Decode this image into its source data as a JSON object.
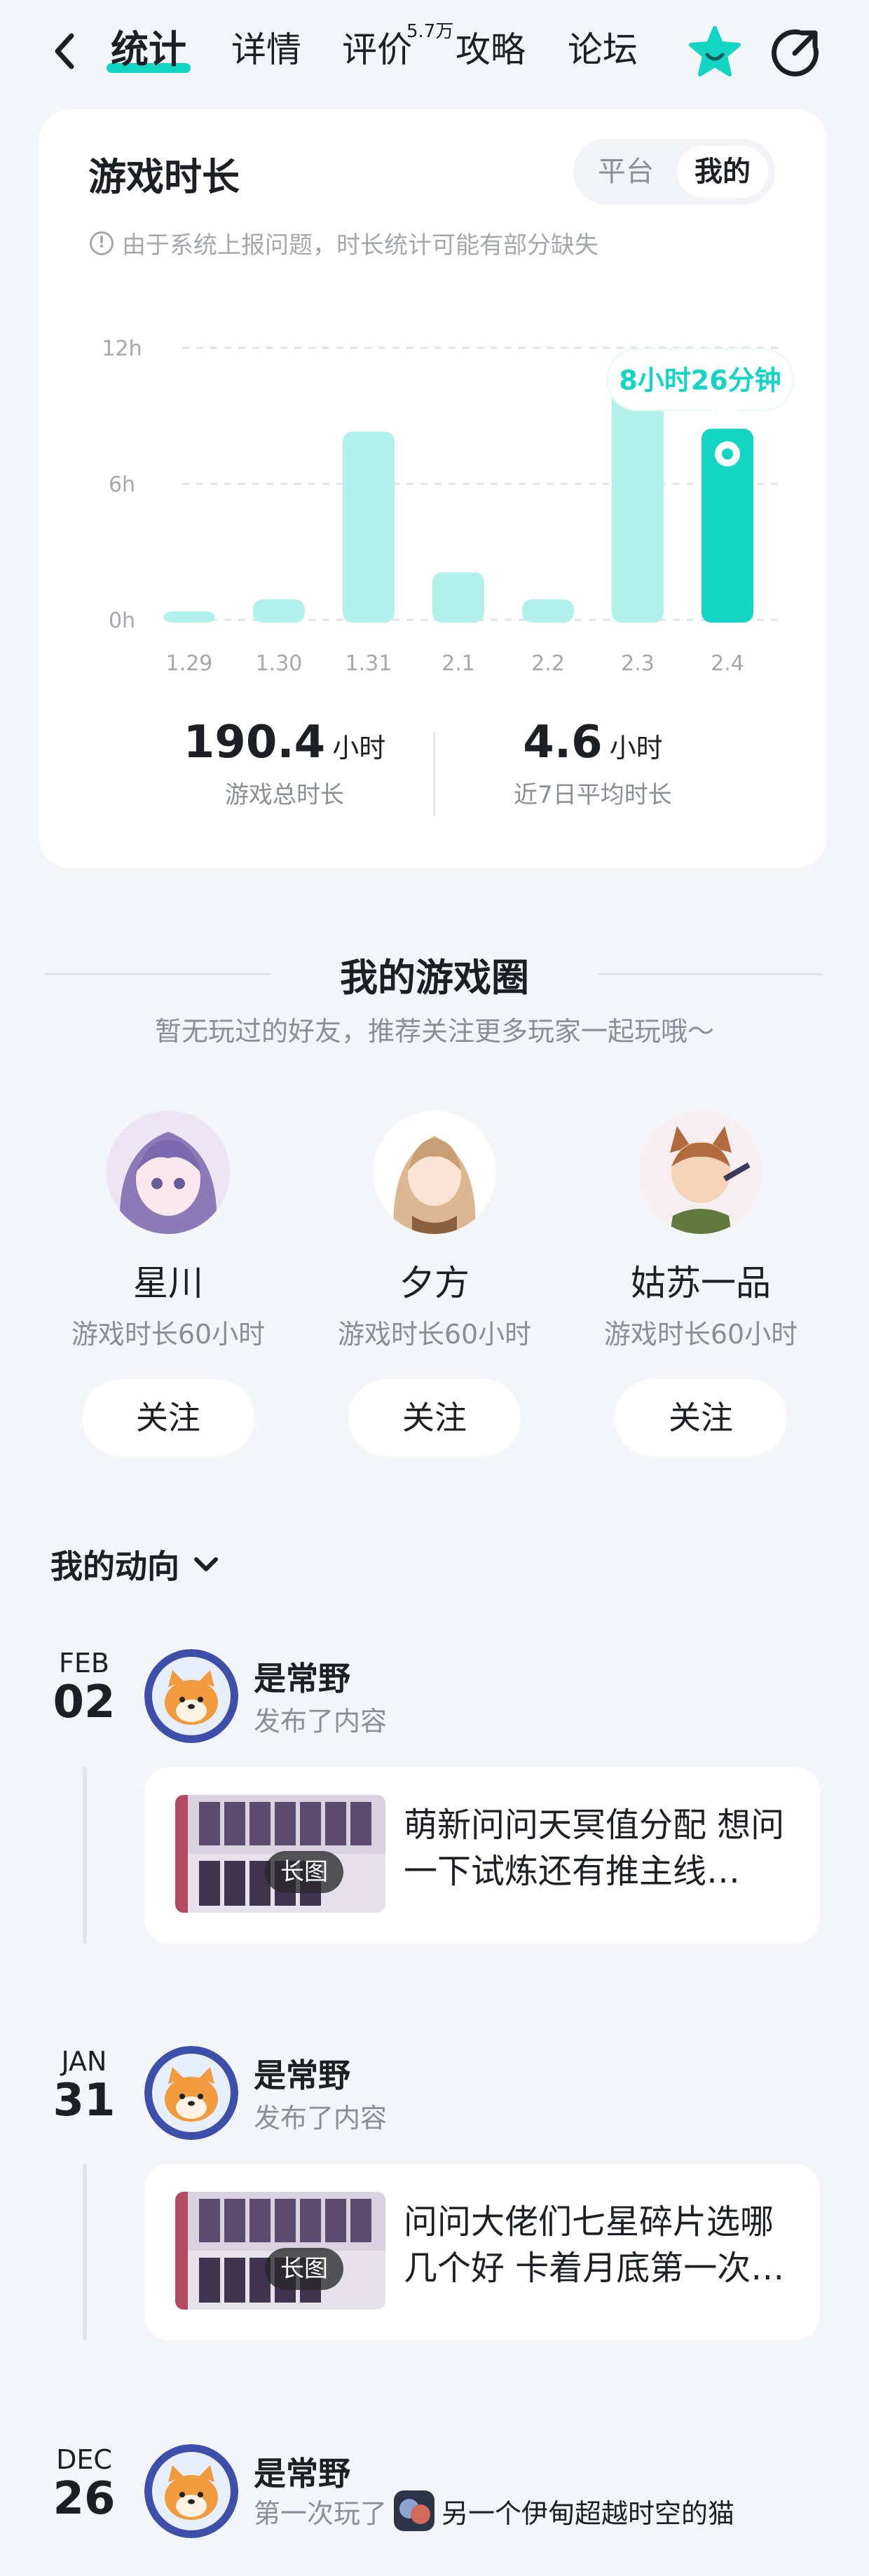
{
  "nav": {
    "tabs": [
      {
        "label": "统计",
        "active": true
      },
      {
        "label": "详情"
      },
      {
        "label": "评价"
      },
      {
        "label": "攻略"
      },
      {
        "label": "论坛"
      }
    ],
    "review_count": "5.7万",
    "icons": {
      "back": "chevron-left-icon",
      "star": "star-icon",
      "share": "share-icon"
    }
  },
  "stats": {
    "title": "游戏时长",
    "toggle": [
      "平台",
      "我的"
    ],
    "toggle_selected": "我的",
    "notice": "由于系统上报问题，时长统计可能有部分缺失",
    "total_value": "190.4",
    "total_unit": "小时",
    "total_label": "游戏总时长",
    "avg_value": "4.6",
    "avg_unit": "小时",
    "avg_label": "近7日平均时长"
  },
  "chart_data": {
    "type": "bar",
    "categories": [
      "1.29",
      "1.30",
      "1.31",
      "2.1",
      "2.2",
      "2.3",
      "2.4"
    ],
    "values": [
      0.3,
      0.9,
      8.3,
      2.1,
      0.9,
      11.5,
      8.43
    ],
    "unit": "h",
    "yticks": [
      "0h",
      "6h",
      "12h"
    ],
    "ylim": [
      0,
      12
    ],
    "grid": true,
    "highlight_index": 6,
    "tooltip": "8小时26分钟",
    "colors": {
      "bar": "#b2f0ea",
      "highlight": "#14d4c4",
      "grid": "#dfe2e6",
      "text": "#a4a8ae"
    }
  },
  "circle": {
    "title": "我的游戏圈",
    "subtitle": "暂无玩过的好友，推荐关注更多玩家一起玩哦～",
    "friends": [
      {
        "name": "星川",
        "sub": "游戏时长60小时",
        "follow": "关注"
      },
      {
        "name": "夕方",
        "sub": "游戏时长60小时",
        "follow": "关注"
      },
      {
        "name": "姑苏一品",
        "sub": "游戏时长60小时",
        "follow": "关注"
      }
    ]
  },
  "feed": {
    "header": "我的动向",
    "items": [
      {
        "month": "FEB",
        "day": "02",
        "user": "是常野",
        "action": "发布了内容",
        "post": "萌新问问天冥值分配 想问一下试炼还有推主线…",
        "badge": "长图"
      },
      {
        "month": "JAN",
        "day": "31",
        "user": "是常野",
        "action": "发布了内容",
        "post": "问问大佬们七星碎片选哪几个好 卡着月底第一次…",
        "badge": "长图"
      },
      {
        "month": "DEC",
        "day": "26",
        "user": "是常野",
        "action": "第一次玩了",
        "game": "另一个伊甸超越时空的猫"
      }
    ]
  },
  "colors": {
    "accent": "#14d4c4",
    "background": "#f3f5f8"
  }
}
